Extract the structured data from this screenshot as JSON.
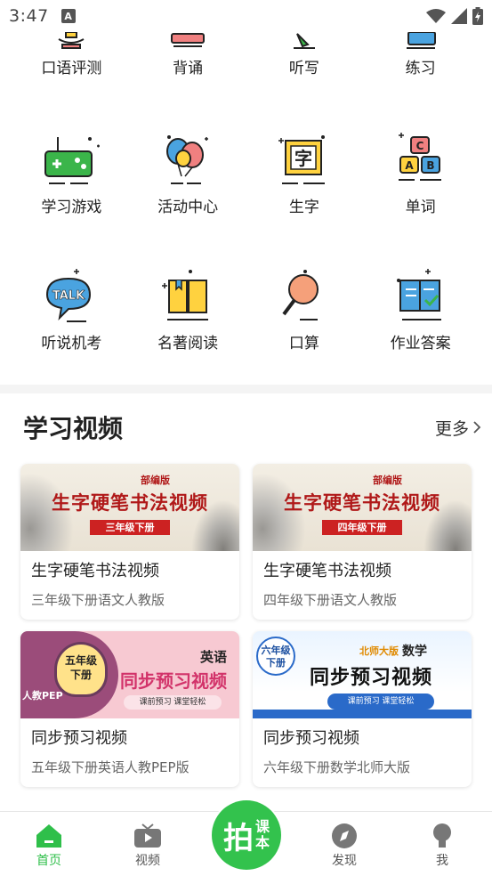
{
  "status_bar": {
    "time": "3:47",
    "notification_icon": "A"
  },
  "grid": {
    "row1": [
      {
        "label": "口语评测",
        "icon": "mic-icon"
      },
      {
        "label": "背诵",
        "icon": "book-icon"
      },
      {
        "label": "听写",
        "icon": "pencil-icon"
      },
      {
        "label": "练习",
        "icon": "notebook-icon"
      }
    ],
    "row2": [
      {
        "label": "学习游戏",
        "icon": "gamepad-icon"
      },
      {
        "label": "活动中心",
        "icon": "balloons-icon"
      },
      {
        "label": "生字",
        "icon": "character-icon",
        "glyph": "字"
      },
      {
        "label": "单词",
        "icon": "letter-blocks-icon",
        "letters": [
          "C",
          "A",
          "B"
        ]
      }
    ],
    "row3": [
      {
        "label": "听说机考",
        "icon": "talk-bubble-icon",
        "glyph": "TALK"
      },
      {
        "label": "名著阅读",
        "icon": "open-book-icon"
      },
      {
        "label": "口算",
        "icon": "magnifier-icon"
      },
      {
        "label": "作业答案",
        "icon": "checked-book-icon"
      }
    ]
  },
  "video_section": {
    "title": "学习视频",
    "more_label": "更多",
    "cards": [
      {
        "title": "生字硬笔书法视频",
        "subtitle": "三年级下册语文人教版",
        "thumb": {
          "edition": "部编版",
          "headline": "生字硬笔书法视频",
          "grade": "三年级下册"
        }
      },
      {
        "title": "生字硬笔书法视频",
        "subtitle": "四年级下册语文人教版",
        "thumb": {
          "edition": "部编版",
          "headline": "生字硬笔书法视频",
          "grade": "四年级下册"
        }
      },
      {
        "title": "同步预习视频",
        "subtitle": "五年级下册英语人教PEP版",
        "thumb": {
          "grade_line1": "五年级",
          "grade_line2": "下册",
          "subject": "英语",
          "headline": "同步预习视频",
          "tagline": "课前预习 课堂轻松",
          "tag": "人教PEP"
        }
      },
      {
        "title": "同步预习视频",
        "subtitle": "六年级下册数学北师大版",
        "thumb": {
          "grade_line1": "六年级",
          "grade_line2": "下册",
          "publisher": "北师大版",
          "subject": "数学",
          "headline": "同步预习视频",
          "tagline": "课前预习 课堂轻松"
        }
      }
    ]
  },
  "tabbar": {
    "tabs": [
      {
        "label": "首页",
        "icon": "home-icon",
        "active": true
      },
      {
        "label": "视频",
        "icon": "tv-icon",
        "active": false
      },
      {
        "label": "发现",
        "icon": "compass-icon",
        "active": false
      },
      {
        "label": "我",
        "icon": "profile-icon",
        "active": false
      }
    ],
    "center_button": {
      "char_main": "拍",
      "char_sub_1": "课",
      "char_sub_2": "本"
    }
  },
  "colors": {
    "accent": "#2fbf4a",
    "icon_green": "#3bb54a",
    "icon_yellow": "#ffd23f",
    "icon_blue": "#4aa3e0",
    "icon_pink": "#f08080"
  }
}
